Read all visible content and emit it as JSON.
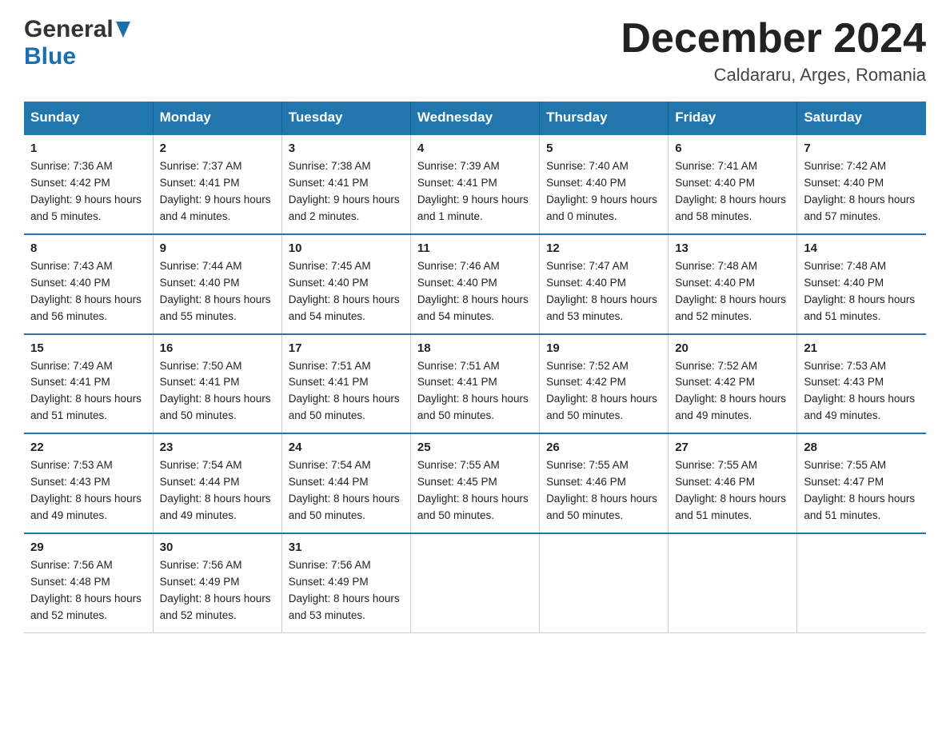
{
  "header": {
    "logo_general": "General",
    "logo_blue": "Blue",
    "title": "December 2024",
    "location": "Caldararu, Arges, Romania"
  },
  "days_of_week": [
    "Sunday",
    "Monday",
    "Tuesday",
    "Wednesday",
    "Thursday",
    "Friday",
    "Saturday"
  ],
  "weeks": [
    [
      {
        "day": "1",
        "sunrise": "7:36 AM",
        "sunset": "4:42 PM",
        "daylight": "9 hours and 5 minutes."
      },
      {
        "day": "2",
        "sunrise": "7:37 AM",
        "sunset": "4:41 PM",
        "daylight": "9 hours and 4 minutes."
      },
      {
        "day": "3",
        "sunrise": "7:38 AM",
        "sunset": "4:41 PM",
        "daylight": "9 hours and 2 minutes."
      },
      {
        "day": "4",
        "sunrise": "7:39 AM",
        "sunset": "4:41 PM",
        "daylight": "9 hours and 1 minute."
      },
      {
        "day": "5",
        "sunrise": "7:40 AM",
        "sunset": "4:40 PM",
        "daylight": "9 hours and 0 minutes."
      },
      {
        "day": "6",
        "sunrise": "7:41 AM",
        "sunset": "4:40 PM",
        "daylight": "8 hours and 58 minutes."
      },
      {
        "day": "7",
        "sunrise": "7:42 AM",
        "sunset": "4:40 PM",
        "daylight": "8 hours and 57 minutes."
      }
    ],
    [
      {
        "day": "8",
        "sunrise": "7:43 AM",
        "sunset": "4:40 PM",
        "daylight": "8 hours and 56 minutes."
      },
      {
        "day": "9",
        "sunrise": "7:44 AM",
        "sunset": "4:40 PM",
        "daylight": "8 hours and 55 minutes."
      },
      {
        "day": "10",
        "sunrise": "7:45 AM",
        "sunset": "4:40 PM",
        "daylight": "8 hours and 54 minutes."
      },
      {
        "day": "11",
        "sunrise": "7:46 AM",
        "sunset": "4:40 PM",
        "daylight": "8 hours and 54 minutes."
      },
      {
        "day": "12",
        "sunrise": "7:47 AM",
        "sunset": "4:40 PM",
        "daylight": "8 hours and 53 minutes."
      },
      {
        "day": "13",
        "sunrise": "7:48 AM",
        "sunset": "4:40 PM",
        "daylight": "8 hours and 52 minutes."
      },
      {
        "day": "14",
        "sunrise": "7:48 AM",
        "sunset": "4:40 PM",
        "daylight": "8 hours and 51 minutes."
      }
    ],
    [
      {
        "day": "15",
        "sunrise": "7:49 AM",
        "sunset": "4:41 PM",
        "daylight": "8 hours and 51 minutes."
      },
      {
        "day": "16",
        "sunrise": "7:50 AM",
        "sunset": "4:41 PM",
        "daylight": "8 hours and 50 minutes."
      },
      {
        "day": "17",
        "sunrise": "7:51 AM",
        "sunset": "4:41 PM",
        "daylight": "8 hours and 50 minutes."
      },
      {
        "day": "18",
        "sunrise": "7:51 AM",
        "sunset": "4:41 PM",
        "daylight": "8 hours and 50 minutes."
      },
      {
        "day": "19",
        "sunrise": "7:52 AM",
        "sunset": "4:42 PM",
        "daylight": "8 hours and 50 minutes."
      },
      {
        "day": "20",
        "sunrise": "7:52 AM",
        "sunset": "4:42 PM",
        "daylight": "8 hours and 49 minutes."
      },
      {
        "day": "21",
        "sunrise": "7:53 AM",
        "sunset": "4:43 PM",
        "daylight": "8 hours and 49 minutes."
      }
    ],
    [
      {
        "day": "22",
        "sunrise": "7:53 AM",
        "sunset": "4:43 PM",
        "daylight": "8 hours and 49 minutes."
      },
      {
        "day": "23",
        "sunrise": "7:54 AM",
        "sunset": "4:44 PM",
        "daylight": "8 hours and 49 minutes."
      },
      {
        "day": "24",
        "sunrise": "7:54 AM",
        "sunset": "4:44 PM",
        "daylight": "8 hours and 50 minutes."
      },
      {
        "day": "25",
        "sunrise": "7:55 AM",
        "sunset": "4:45 PM",
        "daylight": "8 hours and 50 minutes."
      },
      {
        "day": "26",
        "sunrise": "7:55 AM",
        "sunset": "4:46 PM",
        "daylight": "8 hours and 50 minutes."
      },
      {
        "day": "27",
        "sunrise": "7:55 AM",
        "sunset": "4:46 PM",
        "daylight": "8 hours and 51 minutes."
      },
      {
        "day": "28",
        "sunrise": "7:55 AM",
        "sunset": "4:47 PM",
        "daylight": "8 hours and 51 minutes."
      }
    ],
    [
      {
        "day": "29",
        "sunrise": "7:56 AM",
        "sunset": "4:48 PM",
        "daylight": "8 hours and 52 minutes."
      },
      {
        "day": "30",
        "sunrise": "7:56 AM",
        "sunset": "4:49 PM",
        "daylight": "8 hours and 52 minutes."
      },
      {
        "day": "31",
        "sunrise": "7:56 AM",
        "sunset": "4:49 PM",
        "daylight": "8 hours and 53 minutes."
      },
      null,
      null,
      null,
      null
    ]
  ],
  "labels": {
    "sunrise": "Sunrise:",
    "sunset": "Sunset:",
    "daylight": "Daylight:"
  }
}
